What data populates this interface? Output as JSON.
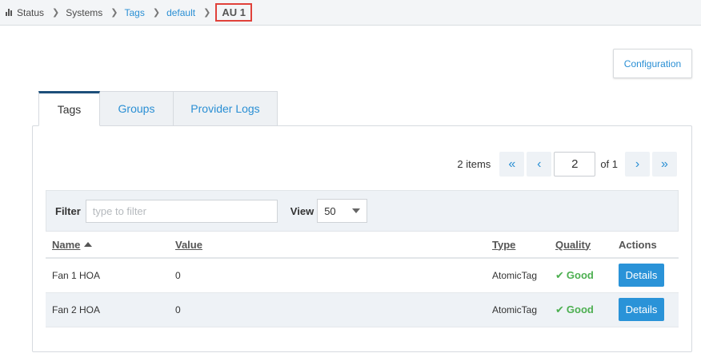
{
  "breadcrumb": {
    "items": [
      {
        "label": "Status",
        "link": false
      },
      {
        "label": "Systems",
        "link": false
      },
      {
        "label": "Tags",
        "link": true
      },
      {
        "label": "default",
        "link": true
      }
    ],
    "current": "AU 1"
  },
  "header": {
    "configuration_label": "Configuration"
  },
  "tabs": [
    {
      "label": "Tags",
      "active": true
    },
    {
      "label": "Groups",
      "active": false
    },
    {
      "label": "Provider Logs",
      "active": false
    }
  ],
  "pager": {
    "count_text": "2 items",
    "first": "«",
    "prev": "‹",
    "next": "›",
    "last": "»",
    "page": "2",
    "of_text": "of 1"
  },
  "filter": {
    "label": "Filter",
    "placeholder": "type to filter",
    "value": ""
  },
  "view": {
    "label": "View",
    "value": "50"
  },
  "table": {
    "columns": [
      "Name",
      "Value",
      "Type",
      "Quality",
      "Actions"
    ],
    "rows": [
      {
        "name": "Fan 1 HOA",
        "value": "0",
        "type": "AtomicTag",
        "quality": "Good",
        "action": "Details"
      },
      {
        "name": "Fan 2 HOA",
        "value": "0",
        "type": "AtomicTag",
        "quality": "Good",
        "action": "Details"
      }
    ]
  },
  "colors": {
    "accent": "#2a8fd4",
    "good": "#4caf50",
    "highlight": "#e0413a"
  }
}
